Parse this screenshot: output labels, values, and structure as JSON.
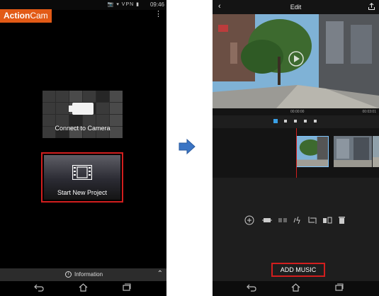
{
  "left_screen": {
    "status_time": "09:46",
    "status_icons": "📷 ▾ VPN ▮",
    "logo_part1": "Action",
    "logo_part2": "Cam",
    "connect_label": "Connect to Camera",
    "start_label": "Start New Project",
    "info_label": "Information",
    "info_icon_glyph": "i"
  },
  "right_screen": {
    "title": "Edit",
    "time_start": "00:00:00",
    "time_end": "00:03:01",
    "add_music_label": "ADD MUSIC"
  },
  "colors": {
    "accent": "#e25a16",
    "highlight": "#d21e1e",
    "arrow": "#3a74c4"
  }
}
